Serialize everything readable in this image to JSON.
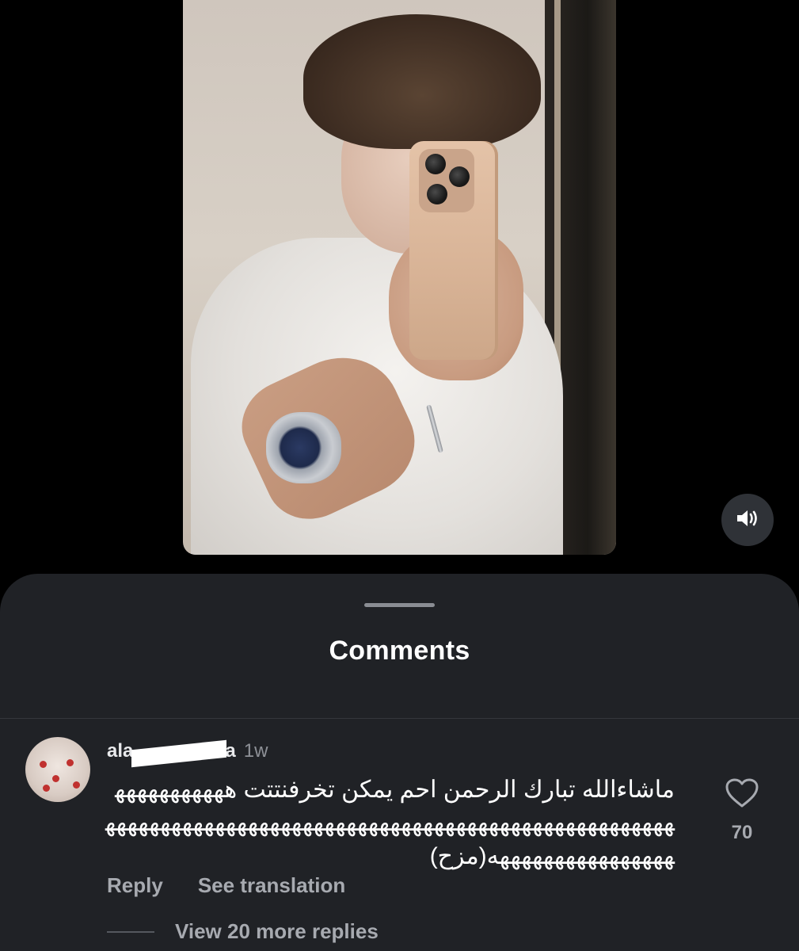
{
  "sheet": {
    "title": "Comments"
  },
  "comment": {
    "username": "ala",
    "username_tail": "a",
    "timestamp": "1w",
    "text": "ماشاءالله تبارك الرحمن احم  يمكن تخرفنتتت هههههههههههههههههههههههههههههههههههههههههههههههههههههههههههههههههههههههههههههههه(مزح)",
    "likes": "70",
    "reply_label": "Reply",
    "translate_label": "See translation",
    "view_replies_label": "View 20 more replies"
  },
  "icons": {
    "sound": "speaker-on-icon",
    "like": "heart-outline-icon"
  },
  "colors": {
    "background": "#000000",
    "sheet": "#202226",
    "muted_text": "#a7aab0"
  }
}
